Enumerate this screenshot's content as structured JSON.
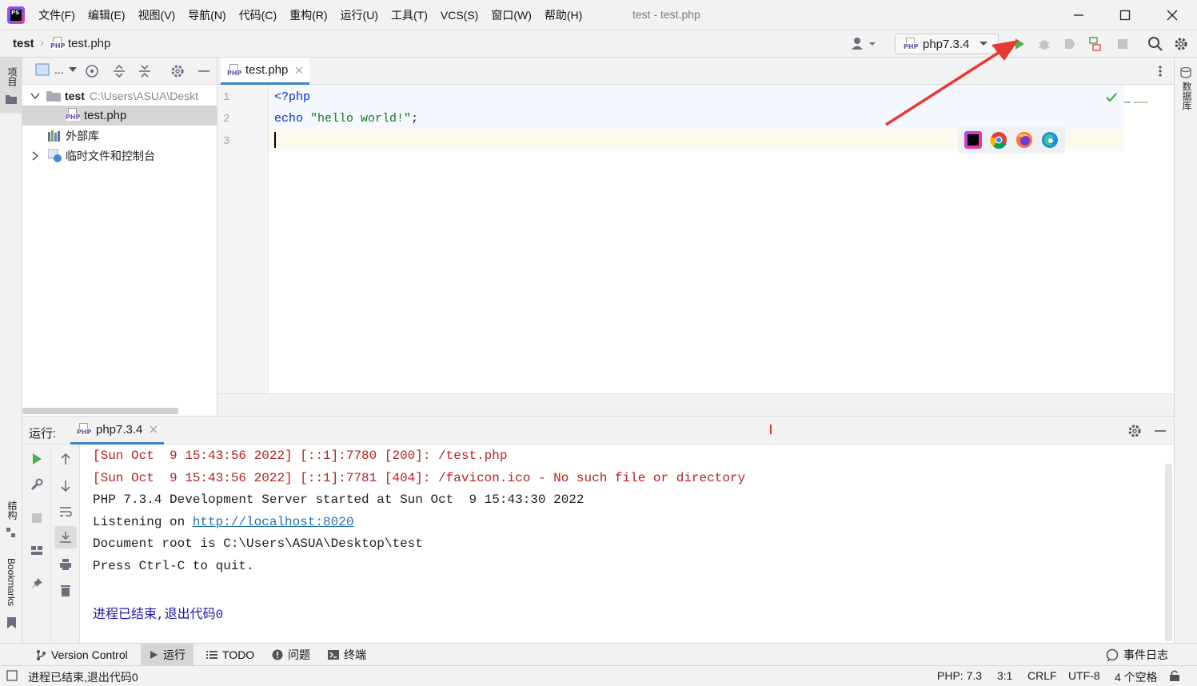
{
  "window": {
    "title": "test - test.php",
    "menu": [
      "文件(F)",
      "编辑(E)",
      "视图(V)",
      "导航(N)",
      "代码(C)",
      "重构(R)",
      "运行(U)",
      "工具(T)",
      "VCS(S)",
      "窗口(W)",
      "帮助(H)"
    ],
    "logo_text": "PS"
  },
  "navbar": {
    "breadcrumb_project": "test",
    "breadcrumb_file": "test.php",
    "run_config": "php7.3.4"
  },
  "left_stripe": {
    "project_label": "项目",
    "structure_label": "结构",
    "bookmarks_label": "Bookmarks"
  },
  "right_stripe": {
    "database_label": "数据库"
  },
  "project_panel": {
    "view_selector": "...",
    "tree": [
      {
        "name": "test",
        "path": "C:\\Users\\ASUA\\Deskt"
      },
      {
        "name": "test.php"
      },
      {
        "name": "外部库"
      },
      {
        "name": "临时文件和控制台"
      }
    ]
  },
  "editor": {
    "tab_label": "test.php",
    "line_numbers": [
      "1",
      "2",
      "3"
    ],
    "code": {
      "line1": "<?php",
      "line2_kw": "echo",
      "line2_str": "\"hello world!\"",
      "line2_end": ";"
    }
  },
  "run_panel": {
    "label": "运行:",
    "tab_label": "php7.3.4",
    "console": {
      "err1": "[Sun Oct  9 15:43:56 2022] [::1]:7780 [200]: /test.php",
      "err2": "[Sun Oct  9 15:43:56 2022] [::1]:7781 [404]: /favicon.ico - No such file or directory",
      "line3": "PHP 7.3.4 Development Server started at Sun Oct  9 15:43:30 2022",
      "line4_prefix": "Listening on ",
      "line4_link": "http://localhost:8020",
      "line5": "Document root is C:\\Users\\ASUA\\Desktop\\test",
      "line6": "Press Ctrl-C to quit.",
      "exit": "进程已结束,退出代码0"
    }
  },
  "tool_tabs": {
    "version_control": "Version Control",
    "run": "运行",
    "todo": "TODO",
    "problems": "问题",
    "terminal": "终端",
    "event_log": "事件日志"
  },
  "statusbar": {
    "message": "进程已结束,退出代码0",
    "php_version": "PHP: 7.3",
    "position": "3:1",
    "line_sep": "CRLF",
    "encoding": "UTF-8",
    "indent": "4 个空格"
  },
  "colors": {
    "keyword": "#0033b3",
    "string": "#067d17",
    "error_text": "#b22222",
    "link": "#2470b3",
    "run_green": "#4caf50",
    "annotation_red": "#e53935"
  }
}
